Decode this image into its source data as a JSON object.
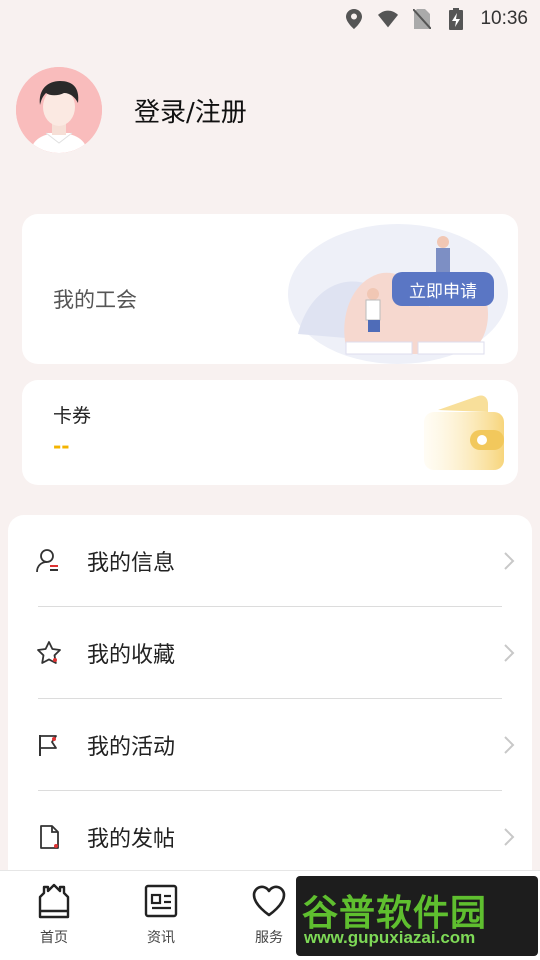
{
  "status_bar": {
    "time": "10:36",
    "icons": [
      "location-icon",
      "wifi-icon",
      "no-sim-icon",
      "battery-charging-icon"
    ]
  },
  "profile": {
    "login_label": "登录/注册",
    "avatar_icon": "user-avatar-icon"
  },
  "union_card": {
    "title": "我的工会",
    "apply_button": "立即申请"
  },
  "coupon_card": {
    "title": "卡券",
    "value": "--"
  },
  "menu": {
    "items": [
      {
        "label": "我的信息",
        "icon": "user-info-icon"
      },
      {
        "label": "我的收藏",
        "icon": "star-icon"
      },
      {
        "label": "我的活动",
        "icon": "flag-icon"
      },
      {
        "label": "我的发帖",
        "icon": "post-icon"
      }
    ]
  },
  "bottom_nav": {
    "items": [
      {
        "label": "首页",
        "icon": "home-icon"
      },
      {
        "label": "资讯",
        "icon": "news-icon"
      },
      {
        "label": "服务",
        "icon": "heart-icon"
      },
      {
        "label": "",
        "icon": "partial-icon"
      },
      {
        "label": "",
        "icon": "profile-icon"
      }
    ]
  },
  "watermark": {
    "title": "谷普软件园",
    "url": "www.gupuxiazai.com"
  },
  "colors": {
    "accent_blue": "#5a76c4",
    "coupon_yellow": "#f4b400",
    "avatar_bg": "#f9bcbc",
    "page_bg": "#f8f1f0"
  }
}
